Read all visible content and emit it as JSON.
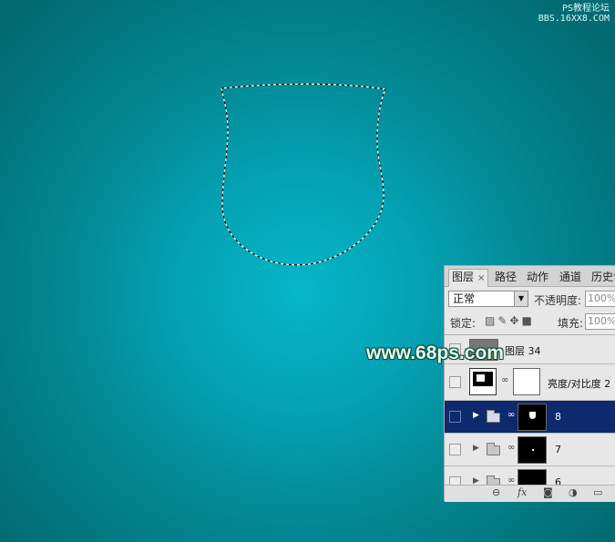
{
  "watermark": {
    "line1": "PS教程论坛",
    "line2": "BBS.16XX8.COM"
  },
  "site_mark": "www.68ps.com",
  "panel": {
    "tabs": [
      {
        "label": "图层",
        "close": "×"
      },
      {
        "label": "路径"
      },
      {
        "label": "动作"
      },
      {
        "label": "通道"
      },
      {
        "label": "历史记"
      }
    ],
    "blend_mode": "正常",
    "opacity_label": "不透明度:",
    "opacity_value": "100%",
    "lock_label": "锁定:",
    "fill_label": "填充:",
    "fill_value": "100%",
    "layers": [
      {
        "name": "图层 34"
      },
      {
        "name": "亮度/对比度 2"
      },
      {
        "name": "8"
      },
      {
        "name": "7"
      },
      {
        "name": "6"
      }
    ],
    "bottom_icons": [
      "link-icon",
      "fx-icon",
      "mask-icon",
      "adjustment-icon",
      "folder-icon"
    ],
    "fx_label": "fx"
  },
  "colors": {
    "selected_layer": "#0d2a6e",
    "canvas": "#04a3b4"
  }
}
